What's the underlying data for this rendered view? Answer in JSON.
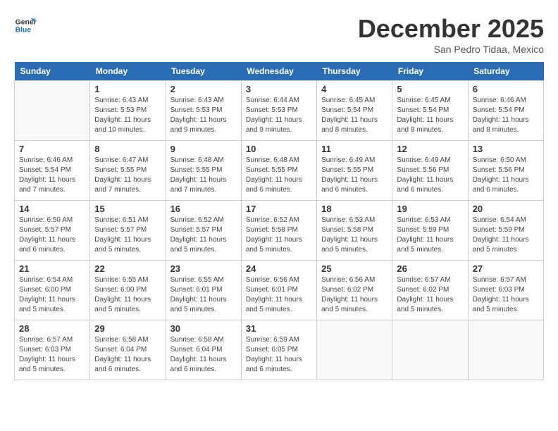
{
  "logo": {
    "line1": "General",
    "line2": "Blue"
  },
  "calendar": {
    "title": "December 2025",
    "subtitle": "San Pedro Tidaa, Mexico"
  },
  "headers": [
    "Sunday",
    "Monday",
    "Tuesday",
    "Wednesday",
    "Thursday",
    "Friday",
    "Saturday"
  ],
  "weeks": [
    [
      {
        "day": "",
        "info": ""
      },
      {
        "day": "1",
        "info": "Sunrise: 6:43 AM\nSunset: 5:53 PM\nDaylight: 11 hours\nand 10 minutes."
      },
      {
        "day": "2",
        "info": "Sunrise: 6:43 AM\nSunset: 5:53 PM\nDaylight: 11 hours\nand 9 minutes."
      },
      {
        "day": "3",
        "info": "Sunrise: 6:44 AM\nSunset: 5:53 PM\nDaylight: 11 hours\nand 9 minutes."
      },
      {
        "day": "4",
        "info": "Sunrise: 6:45 AM\nSunset: 5:54 PM\nDaylight: 11 hours\nand 8 minutes."
      },
      {
        "day": "5",
        "info": "Sunrise: 6:45 AM\nSunset: 5:54 PM\nDaylight: 11 hours\nand 8 minutes."
      },
      {
        "day": "6",
        "info": "Sunrise: 6:46 AM\nSunset: 5:54 PM\nDaylight: 11 hours\nand 8 minutes."
      }
    ],
    [
      {
        "day": "7",
        "info": "Sunrise: 6:46 AM\nSunset: 5:54 PM\nDaylight: 11 hours\nand 7 minutes."
      },
      {
        "day": "8",
        "info": "Sunrise: 6:47 AM\nSunset: 5:55 PM\nDaylight: 11 hours\nand 7 minutes."
      },
      {
        "day": "9",
        "info": "Sunrise: 6:48 AM\nSunset: 5:55 PM\nDaylight: 11 hours\nand 7 minutes."
      },
      {
        "day": "10",
        "info": "Sunrise: 6:48 AM\nSunset: 5:55 PM\nDaylight: 11 hours\nand 6 minutes."
      },
      {
        "day": "11",
        "info": "Sunrise: 6:49 AM\nSunset: 5:55 PM\nDaylight: 11 hours\nand 6 minutes."
      },
      {
        "day": "12",
        "info": "Sunrise: 6:49 AM\nSunset: 5:56 PM\nDaylight: 11 hours\nand 6 minutes."
      },
      {
        "day": "13",
        "info": "Sunrise: 6:50 AM\nSunset: 5:56 PM\nDaylight: 11 hours\nand 6 minutes."
      }
    ],
    [
      {
        "day": "14",
        "info": "Sunrise: 6:50 AM\nSunset: 5:57 PM\nDaylight: 11 hours\nand 6 minutes."
      },
      {
        "day": "15",
        "info": "Sunrise: 6:51 AM\nSunset: 5:57 PM\nDaylight: 11 hours\nand 5 minutes."
      },
      {
        "day": "16",
        "info": "Sunrise: 6:52 AM\nSunset: 5:57 PM\nDaylight: 11 hours\nand 5 minutes."
      },
      {
        "day": "17",
        "info": "Sunrise: 6:52 AM\nSunset: 5:58 PM\nDaylight: 11 hours\nand 5 minutes."
      },
      {
        "day": "18",
        "info": "Sunrise: 6:53 AM\nSunset: 5:58 PM\nDaylight: 11 hours\nand 5 minutes."
      },
      {
        "day": "19",
        "info": "Sunrise: 6:53 AM\nSunset: 5:59 PM\nDaylight: 11 hours\nand 5 minutes."
      },
      {
        "day": "20",
        "info": "Sunrise: 6:54 AM\nSunset: 5:59 PM\nDaylight: 11 hours\nand 5 minutes."
      }
    ],
    [
      {
        "day": "21",
        "info": "Sunrise: 6:54 AM\nSunset: 6:00 PM\nDaylight: 11 hours\nand 5 minutes."
      },
      {
        "day": "22",
        "info": "Sunrise: 6:55 AM\nSunset: 6:00 PM\nDaylight: 11 hours\nand 5 minutes."
      },
      {
        "day": "23",
        "info": "Sunrise: 6:55 AM\nSunset: 6:01 PM\nDaylight: 11 hours\nand 5 minutes."
      },
      {
        "day": "24",
        "info": "Sunrise: 6:56 AM\nSunset: 6:01 PM\nDaylight: 11 hours\nand 5 minutes."
      },
      {
        "day": "25",
        "info": "Sunrise: 6:56 AM\nSunset: 6:02 PM\nDaylight: 11 hours\nand 5 minutes."
      },
      {
        "day": "26",
        "info": "Sunrise: 6:57 AM\nSunset: 6:02 PM\nDaylight: 11 hours\nand 5 minutes."
      },
      {
        "day": "27",
        "info": "Sunrise: 6:57 AM\nSunset: 6:03 PM\nDaylight: 11 hours\nand 5 minutes."
      }
    ],
    [
      {
        "day": "28",
        "info": "Sunrise: 6:57 AM\nSunset: 6:03 PM\nDaylight: 11 hours\nand 5 minutes."
      },
      {
        "day": "29",
        "info": "Sunrise: 6:58 AM\nSunset: 6:04 PM\nDaylight: 11 hours\nand 6 minutes."
      },
      {
        "day": "30",
        "info": "Sunrise: 6:58 AM\nSunset: 6:04 PM\nDaylight: 11 hours\nand 6 minutes."
      },
      {
        "day": "31",
        "info": "Sunrise: 6:59 AM\nSunset: 6:05 PM\nDaylight: 11 hours\nand 6 minutes."
      },
      {
        "day": "",
        "info": ""
      },
      {
        "day": "",
        "info": ""
      },
      {
        "day": "",
        "info": ""
      }
    ]
  ]
}
